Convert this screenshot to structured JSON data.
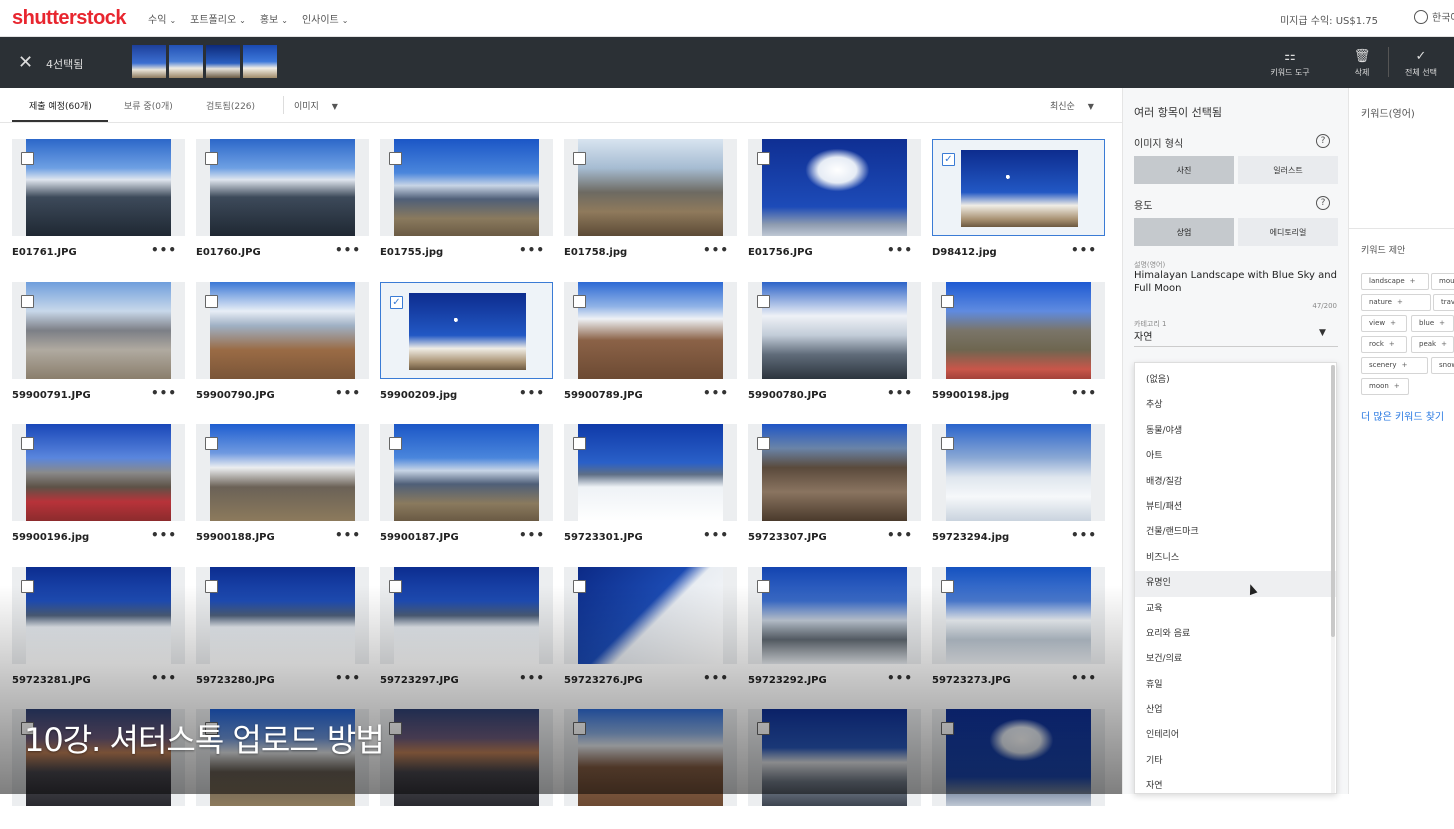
{
  "topnav": {
    "logo": "shutterstock",
    "items": [
      {
        "label": "수익",
        "active": false
      },
      {
        "label": "포트폴리오",
        "active": true
      },
      {
        "label": "홍보",
        "active": false
      },
      {
        "label": "인사이트",
        "active": false
      }
    ],
    "earnings": "미지급 수익: US$1.75",
    "language": "한국어"
  },
  "selection_bar": {
    "count_label": "4선택됨",
    "tools": {
      "keyword_tool": "키워드 도구",
      "delete": "삭제",
      "select_all": "전체 선택"
    }
  },
  "tabs": {
    "items": [
      "제출 예정(60개)",
      "보류 중(0개)",
      "검토됨(226)"
    ],
    "image_filter": "이미지",
    "sort": "최신순"
  },
  "images": [
    {
      "name": "E01761.JPG",
      "selected": false,
      "scene": "clouds-valley"
    },
    {
      "name": "E01760.JPG",
      "selected": false,
      "scene": "clouds-valley"
    },
    {
      "name": "E01755.jpg",
      "selected": false,
      "scene": "blue-peaks"
    },
    {
      "name": "E01758.jpg",
      "selected": false,
      "scene": "dry-valley"
    },
    {
      "name": "E01756.JPG",
      "selected": false,
      "scene": "cloud-sky"
    },
    {
      "name": "D98412.jpg",
      "selected": true,
      "scene": "peak-moon"
    },
    {
      "name": "59900791.JPG",
      "selected": false,
      "scene": "trekkers"
    },
    {
      "name": "59900790.JPG",
      "selected": false,
      "scene": "trail-clouds"
    },
    {
      "name": "59900209.jpg",
      "selected": true,
      "scene": "peak-moon"
    },
    {
      "name": "59900789.JPG",
      "selected": false,
      "scene": "trail-peak"
    },
    {
      "name": "59900780.JPG",
      "selected": false,
      "scene": "cloudy-ridge"
    },
    {
      "name": "59900198.jpg",
      "selected": false,
      "scene": "village"
    },
    {
      "name": "59900196.jpg",
      "selected": false,
      "scene": "red-roofs"
    },
    {
      "name": "59900188.JPG",
      "selected": false,
      "scene": "ama-dablam"
    },
    {
      "name": "59900187.JPG",
      "selected": false,
      "scene": "blue-peaks"
    },
    {
      "name": "59723301.JPG",
      "selected": false,
      "scene": "glacier"
    },
    {
      "name": "59723307.JPG",
      "selected": false,
      "scene": "rocky-climb"
    },
    {
      "name": "59723294.jpg",
      "selected": false,
      "scene": "snow-ridge"
    },
    {
      "name": "59723281.JPG",
      "selected": false,
      "scene": "snowfield"
    },
    {
      "name": "59723280.JPG",
      "selected": false,
      "scene": "snowfield"
    },
    {
      "name": "59723297.JPG",
      "selected": false,
      "scene": "snowfield"
    },
    {
      "name": "59723276.JPG",
      "selected": false,
      "scene": "snow-slope"
    },
    {
      "name": "59723292.JPG",
      "selected": false,
      "scene": "ice-ridge"
    },
    {
      "name": "59723273.JPG",
      "selected": false,
      "scene": "ice-wall"
    },
    {
      "name": "",
      "selected": false,
      "scene": "dusk"
    },
    {
      "name": "",
      "selected": false,
      "scene": "ama-dablam"
    },
    {
      "name": "",
      "selected": false,
      "scene": "dusk"
    },
    {
      "name": "",
      "selected": false,
      "scene": "trail-peak"
    },
    {
      "name": "",
      "selected": false,
      "scene": "cloud-peak"
    },
    {
      "name": "",
      "selected": false,
      "scene": "cloud-sky"
    }
  ],
  "detail_panel": {
    "title": "여러 항목이 선택됨",
    "image_type_label": "이미지 형식",
    "image_type_options": [
      "사진",
      "일러스트"
    ],
    "image_type_selected": "사진",
    "usage_label": "용도",
    "usage_options": [
      "상업",
      "에디토리얼"
    ],
    "usage_selected": "상업",
    "description_label": "설명(영어)",
    "description": "Himalayan Landscape with Blue Sky and Full Moon",
    "char_count": "47/200",
    "category_label": "카테고리 1",
    "category_value": "자연",
    "help_icon": "?"
  },
  "category_dropdown": {
    "options": [
      "(없음)",
      "추상",
      "동물/야생",
      "아트",
      "배경/질감",
      "뷰티/패션",
      "건물/랜드마크",
      "비즈니스",
      "유명인",
      "교육",
      "요리와 음료",
      "보건/의료",
      "휴일",
      "산업",
      "인테리어",
      "기타",
      "자연"
    ],
    "hovered": "유명인"
  },
  "keyword_panel": {
    "title": "키워드(영어)",
    "suggestions_label": "키워드 제안",
    "chips": [
      "landscape",
      "mountain",
      "nature",
      "travel",
      "view",
      "blue",
      "rock",
      "peak",
      "scenery",
      "snow",
      "moon"
    ],
    "more_label": "더 많은 키워드 찾기"
  },
  "overlay_caption": "10강. 셔터스톡 업로드 방법",
  "colors": {
    "brand_red": "#e8262f",
    "selection_blue": "#3a7bd5",
    "dark_bar": "#2b3035",
    "link_blue": "#2a7ae2"
  }
}
